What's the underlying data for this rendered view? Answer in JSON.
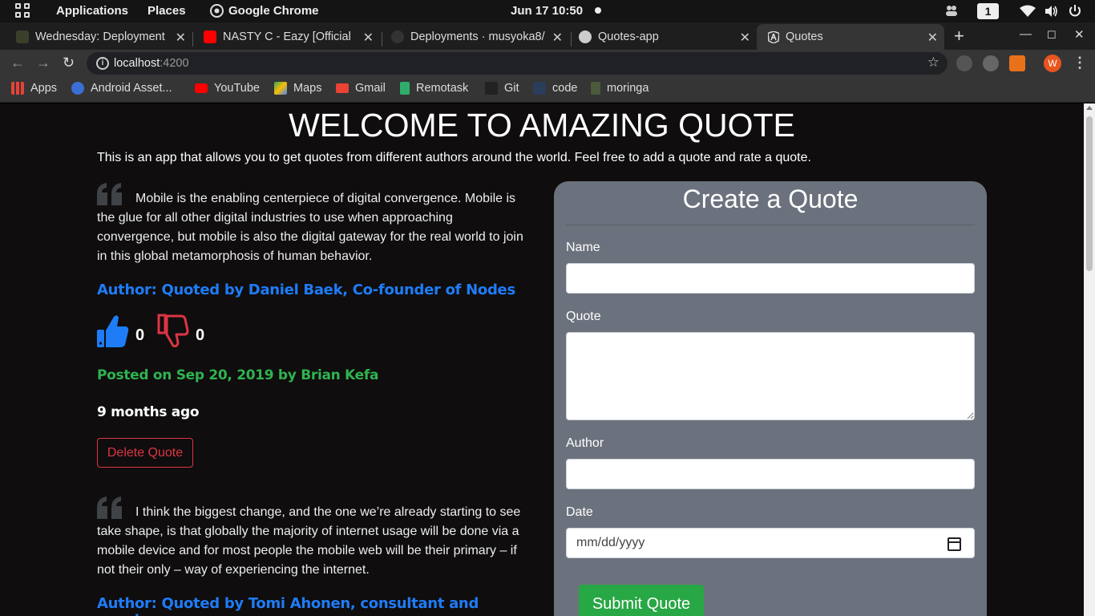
{
  "system_bar": {
    "applications": "Applications",
    "places": "Places",
    "active_app": "Google Chrome",
    "clock": "Jun 17  10:50",
    "workspace": "1"
  },
  "tabs": [
    {
      "title": "Wednesday: Deployment",
      "favicon_color": "#3a3f2a"
    },
    {
      "title": "NASTY C - Eazy [Official",
      "favicon_color": "#ff0000"
    },
    {
      "title": "Deployments · musyoka8/",
      "favicon_color": "#333333"
    },
    {
      "title": "Quotes-app",
      "favicon_color": "#cccccc"
    },
    {
      "title": "Quotes",
      "favicon_color": "#dddddd"
    }
  ],
  "omnibox": {
    "host": "localhost",
    "port": ":4200"
  },
  "profile_initial": "W",
  "bookmarks": [
    {
      "label": "Apps",
      "color": "#e94235"
    },
    {
      "label": "Android Asset...",
      "color": "#3b6fd6"
    },
    {
      "label": "YouTube",
      "color": "#ff0000"
    },
    {
      "label": "Maps",
      "color": "#34a853"
    },
    {
      "label": "Gmail",
      "color": "#ea4335"
    },
    {
      "label": "Remotask",
      "color": "#2fae6b"
    },
    {
      "label": "Git",
      "color": "#222222"
    },
    {
      "label": "code",
      "color": "#2a3d5a"
    },
    {
      "label": "moringa",
      "color": "#4a5a3a"
    }
  ],
  "page": {
    "title": "WELCOME TO AMAZING QUOTE",
    "intro": "This is an app that allows you to get quotes from different authors around the world. Feel free to add a quote and rate a quote."
  },
  "quotes": [
    {
      "text": "Mobile is the enabling centerpiece of digital convergence. Mobile is the glue for all other digital industries to use when approaching convergence, but mobile is also the digital gateway for the real world to join in this global metamorphosis of human behavior.",
      "author": "Author: Quoted by  Daniel Baek, Co-founder of Nodes",
      "upvotes": "0",
      "downvotes": "0",
      "posted": "Posted on Sep 20, 2019 by Brian Kefa",
      "ago": "9 months ago",
      "delete_label": "Delete Quote"
    },
    {
      "text": "I think the biggest change, and the one we’re already starting to see take shape, is that globally the majority of internet usage will be done via a mobile device and for most people the mobile web will be their primary – if not their only – way of experiencing the internet.",
      "author": "Author: Quoted by Tomi Ahonen, consultant and speaker"
    }
  ],
  "form": {
    "title": "Create a Quote",
    "name_label": "Name",
    "quote_label": "Quote",
    "author_label": "Author",
    "date_label": "Date",
    "date_placeholder": "mm/dd/yyyy",
    "submit_label": "Submit Quote"
  },
  "colors": {
    "author": "#1e7cf7",
    "posted": "#2fb34f",
    "delete": "#dc3545",
    "submit": "#28a745",
    "card": "#6c727d"
  }
}
